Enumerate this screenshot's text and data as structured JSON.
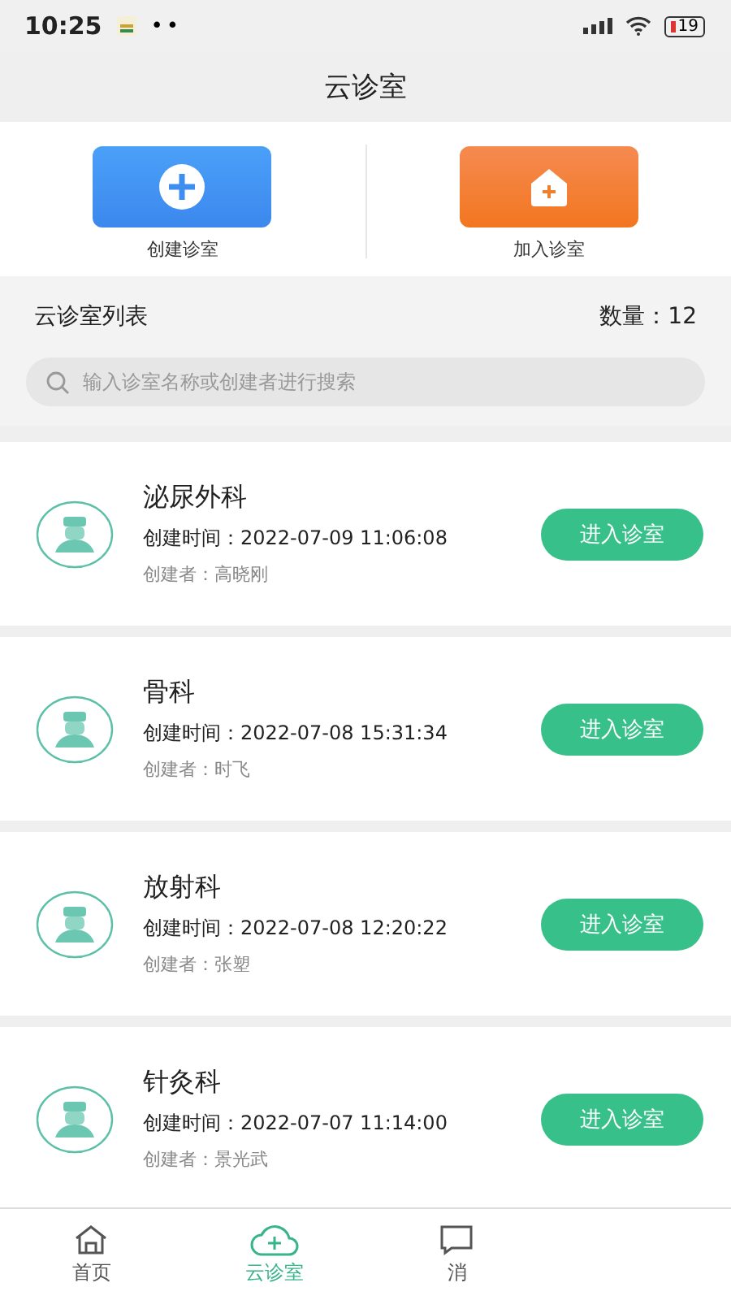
{
  "status_bar": {
    "time": "10:25",
    "dots": "••",
    "battery": "19"
  },
  "header": {
    "title": "云诊室"
  },
  "actions": [
    {
      "kind": "create",
      "label": "创建诊室"
    },
    {
      "kind": "join",
      "label": "加入诊室"
    }
  ],
  "list_header": {
    "title": "云诊室列表",
    "count": "数量：12"
  },
  "search": {
    "placeholder": "输入诊室名称或创建者进行搜索"
  },
  "rooms": [
    {
      "name": "泌尿外科",
      "created": "创建时间：2022-07-09 11:06:08",
      "creator": "创建者：高晓刚",
      "button": "进入诊室"
    },
    {
      "name": "骨科",
      "created": "创建时间：2022-07-08 15:31:34",
      "creator": "创建者：时飞",
      "button": "进入诊室"
    },
    {
      "name": "放射科",
      "created": "创建时间：2022-07-08 12:20:22",
      "creator": "创建者：张塑",
      "button": "进入诊室"
    },
    {
      "name": "针灸科",
      "created": "创建时间：2022-07-07 11:14:00",
      "creator": "创建者：景光武",
      "button": "进入诊室"
    }
  ],
  "tabs": [
    {
      "kind": "home",
      "label": "首页",
      "selected": false
    },
    {
      "kind": "cloud",
      "label": "云诊室",
      "selected": true
    },
    {
      "kind": "message",
      "label": "消",
      "selected": false
    }
  ]
}
